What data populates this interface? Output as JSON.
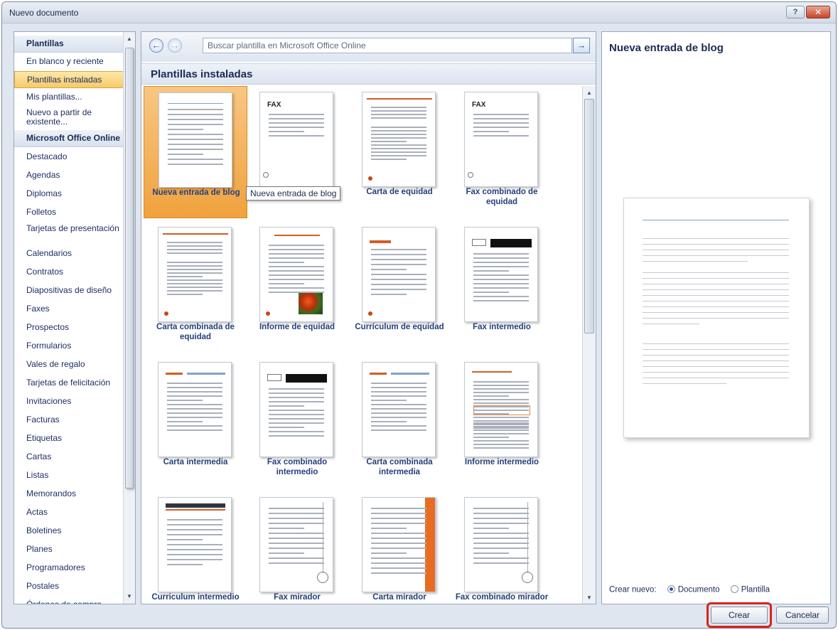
{
  "window": {
    "title": "Nuevo documento",
    "help_glyph": "?",
    "close_glyph": "✕"
  },
  "sidebar": {
    "items": [
      {
        "label": "Plantillas",
        "type": "header"
      },
      {
        "label": "En blanco y reciente",
        "type": "item"
      },
      {
        "label": "Plantillas instaladas",
        "type": "selected"
      },
      {
        "label": "Mis plantillas...",
        "type": "item"
      },
      {
        "label": "Nuevo a partir de existente...",
        "type": "item"
      },
      {
        "label": "Microsoft Office Online",
        "type": "header"
      },
      {
        "label": "Destacado",
        "type": "item"
      },
      {
        "label": "Agendas",
        "type": "item"
      },
      {
        "label": "Diplomas",
        "type": "item"
      },
      {
        "label": "Folletos",
        "type": "item"
      },
      {
        "label": "Tarjetas de presentación",
        "type": "item"
      },
      {
        "label": "Calendarios",
        "type": "item"
      },
      {
        "label": "Contratos",
        "type": "item"
      },
      {
        "label": "Diapositivas de diseño",
        "type": "item"
      },
      {
        "label": "Faxes",
        "type": "item"
      },
      {
        "label": "Prospectos",
        "type": "item"
      },
      {
        "label": "Formularios",
        "type": "item"
      },
      {
        "label": "Vales de regalo",
        "type": "item"
      },
      {
        "label": "Tarjetas de felicitación",
        "type": "item"
      },
      {
        "label": "Invitaciones",
        "type": "item"
      },
      {
        "label": "Facturas",
        "type": "item"
      },
      {
        "label": "Etiquetas",
        "type": "item"
      },
      {
        "label": "Cartas",
        "type": "item"
      },
      {
        "label": "Listas",
        "type": "item"
      },
      {
        "label": "Memorandos",
        "type": "item"
      },
      {
        "label": "Actas",
        "type": "item"
      },
      {
        "label": "Boletines",
        "type": "item"
      },
      {
        "label": "Planes",
        "type": "item"
      },
      {
        "label": "Programadores",
        "type": "item"
      },
      {
        "label": "Postales",
        "type": "item"
      },
      {
        "label": "Órdenes de compra",
        "type": "item"
      }
    ]
  },
  "toolbar": {
    "back_glyph": "←",
    "forward_glyph": "→",
    "search_placeholder": "Buscar plantilla en Microsoft Office Online",
    "go_glyph": "→"
  },
  "gallery": {
    "heading": "Plantillas instaladas",
    "tooltip": "Nueva entrada de blog",
    "fax_word": "FAX",
    "templates": [
      {
        "label": "Nueva entrada de blog",
        "style": "blog"
      },
      {
        "label": "",
        "style": "fax-equity"
      },
      {
        "label": "Carta de equidad",
        "style": "letter-equity"
      },
      {
        "label": "Fax combinado de equidad",
        "style": "fax-equity"
      },
      {
        "label": "Carta combinada de equidad",
        "style": "letter-equity"
      },
      {
        "label": "Informe de equidad",
        "style": "report-equity"
      },
      {
        "label": "Currículum de equidad",
        "style": "resume-equity"
      },
      {
        "label": "Fax intermedio",
        "style": "fax-black"
      },
      {
        "label": "Carta intermedia",
        "style": "letter-median"
      },
      {
        "label": "Fax combinado intermedio",
        "style": "fax-black"
      },
      {
        "label": "Carta combinada intermedia",
        "style": "letter-median"
      },
      {
        "label": "Informe intermedio",
        "style": "report-median"
      },
      {
        "label": "Curriculum intermedio",
        "style": "resume-median"
      },
      {
        "label": "Fax mirador",
        "style": "oriel"
      },
      {
        "label": "Carta mirador",
        "style": "oriel-orange"
      },
      {
        "label": "Fax combinado mirador",
        "style": "oriel"
      }
    ]
  },
  "preview": {
    "title": "Nueva entrada de blog",
    "create_new_label": "Crear nuevo:",
    "option_document": "Documento",
    "option_template": "Plantilla",
    "selected_option": "Documento"
  },
  "buttons": {
    "create": "Crear",
    "cancel": "Cancelar"
  },
  "colors": {
    "selection": "#f0a23d",
    "accent_orange": "#d25d24",
    "highlight_red": "#d8231c",
    "link_blue": "#25407a"
  }
}
